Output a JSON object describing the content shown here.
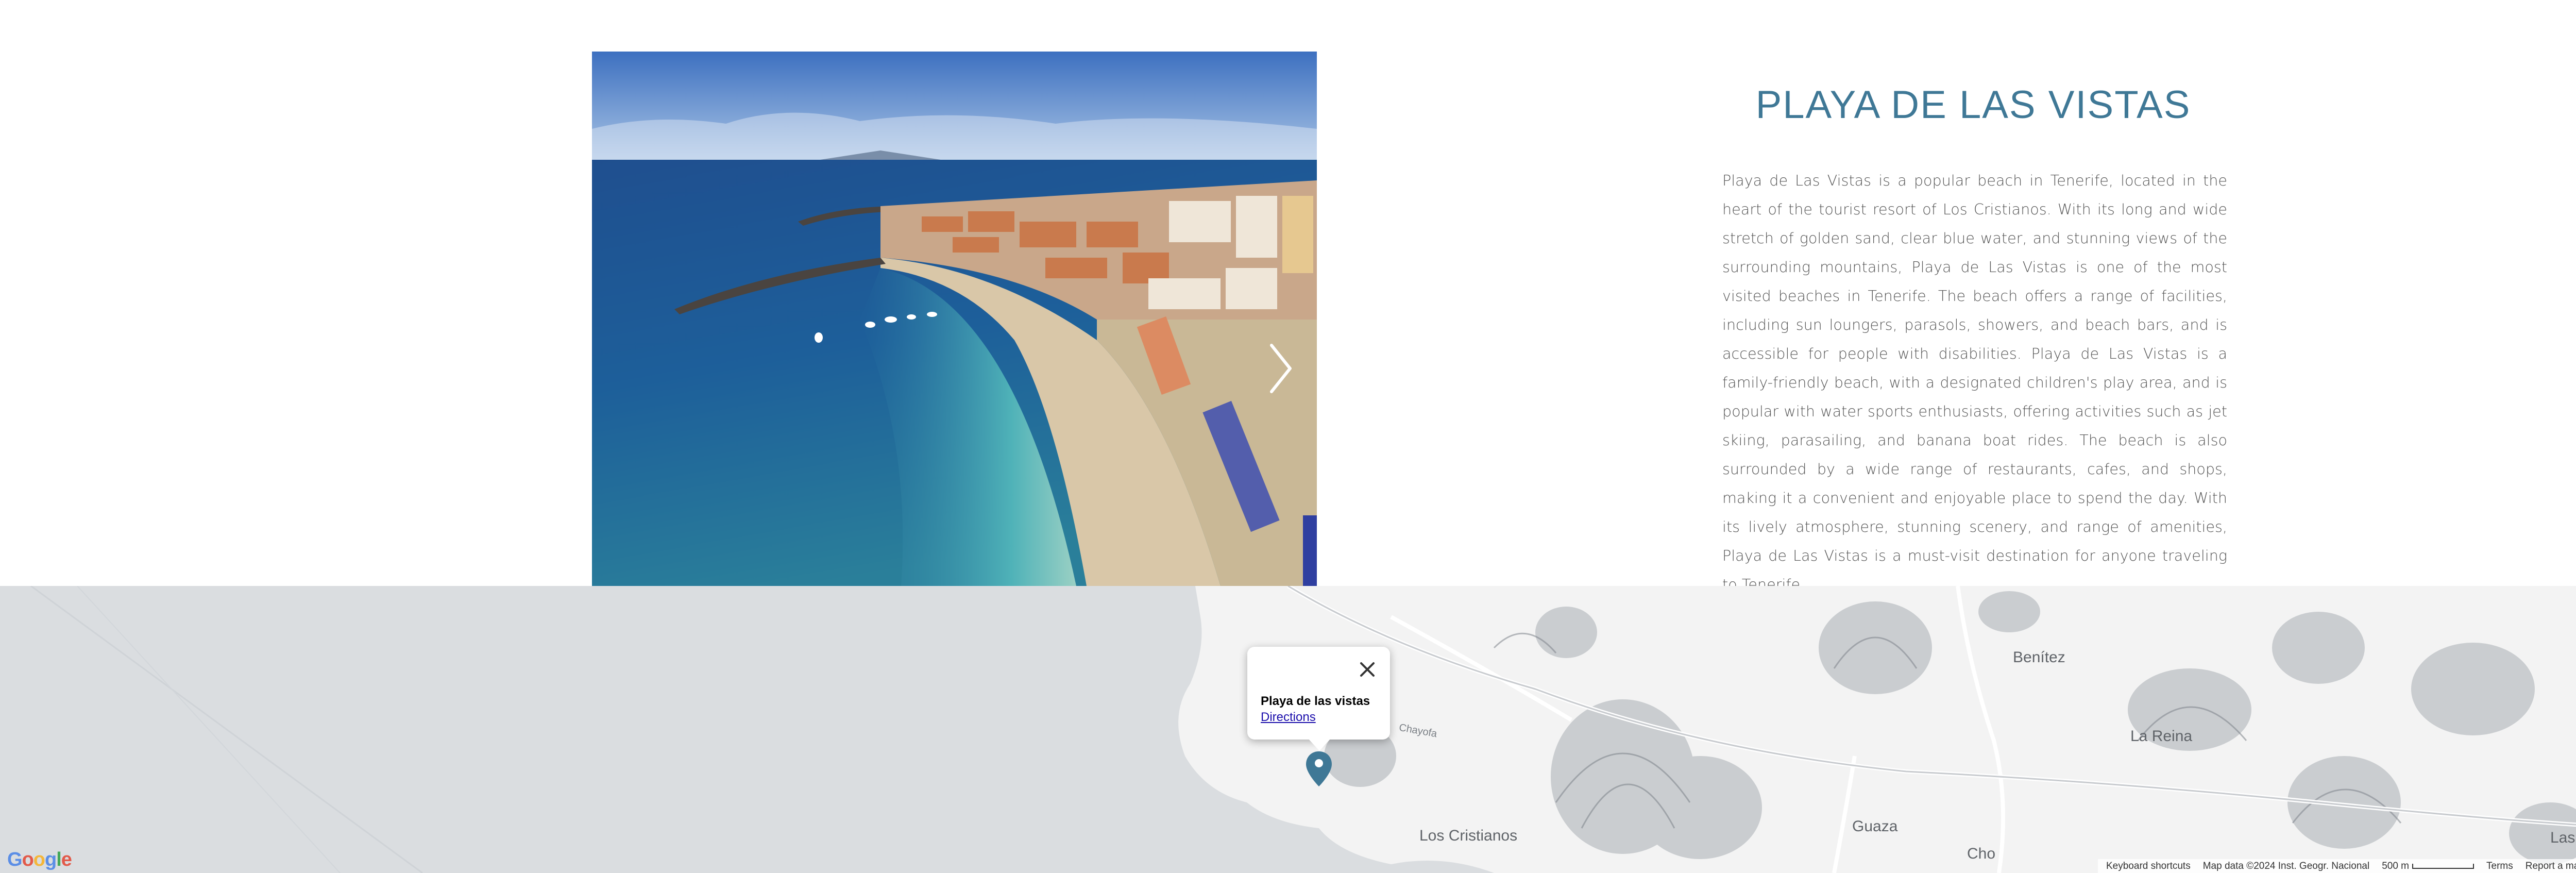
{
  "article": {
    "title": "PLAYA DE LAS VISTAS",
    "description": "Playa de Las Vistas is a popular beach in Tenerife, located in the heart of the tourist resort of Los Cristianos. With its long and wide stretch of golden sand, clear blue water, and stunning views of the surrounding mountains, Playa de Las Vistas is one of the most visited beaches in Tenerife. The beach offers a range of facilities, including sun loungers, parasols, showers, and beach bars, and is accessible for people with disabilities. Playa de Las Vistas is a family-friendly beach, with a designated children's play area, and is popular with water sports enthusiasts, offering activities such as jet skiing, parasailing, and banana boat rides. The beach is also surrounded by a wide range of restaurants, cafes, and shops, making it a convenient and enjoyable place to spend the day. With its lively atmosphere, stunning scenery, and range of amenities, Playa de Las Vistas is a must-visit destination for anyone traveling to Tenerife."
  },
  "carousel": {
    "next_icon": "chevron-right-icon"
  },
  "map": {
    "info_window": {
      "place_name": "Playa de las vistas",
      "directions_label": "Directions",
      "close_icon": "close-icon"
    },
    "labels": {
      "benitez": "Benítez",
      "la_reina": "La Reina",
      "los_cristianos": "Los Cristianos",
      "guaza": "Guaza",
      "cho": "Cho",
      "las_chafiras": "Las Chafiras",
      "chayofa": "Chayofa"
    },
    "google_logo": "Google",
    "attribution": {
      "keyboard_shortcuts": "Keyboard shortcuts",
      "map_data": "Map data ©2024 Inst. Geogr. Nacional",
      "scale": "500 m",
      "terms": "Terms",
      "report": "Report a map error"
    },
    "fullscreen_icon": "fullscreen-icon",
    "marker_color": "#3f7896"
  },
  "colors": {
    "accent": "#3f7896",
    "body_text": "#555555",
    "sea": "#dadde0"
  }
}
